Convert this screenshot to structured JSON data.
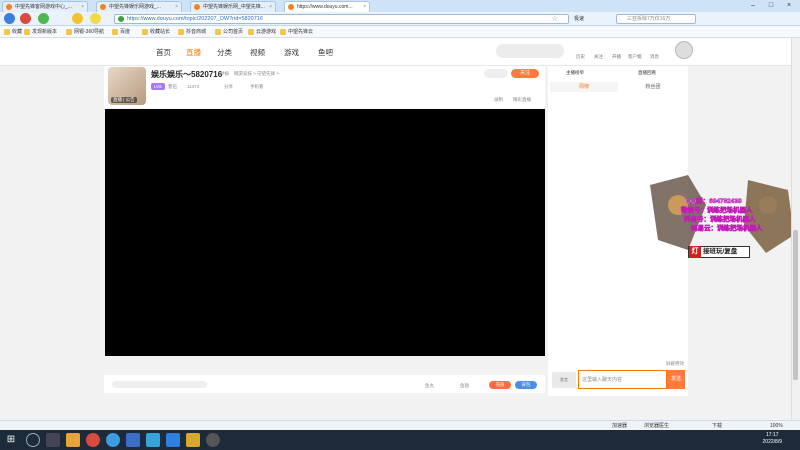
{
  "browser": {
    "tabs": [
      {
        "label": "中望先锋客网游戏中心_...",
        "active": false
      },
      {
        "label": "中望先锋娱乐网游戏_...",
        "active": false
      },
      {
        "label": "中望先锋娱乐网_中望先锋...",
        "active": false
      },
      {
        "label": "https://www.douyu.com...",
        "active": true
      }
    ],
    "url": "https://www.douyu.com/topic/202207_OW?rid=5820716",
    "speed_label": "极速",
    "search_placeholder": "三亚拆除7万仅16万",
    "bookmarks": [
      "收藏",
      "发现新版本",
      "网银-360导航",
      "百度",
      "收藏站长",
      "抖音商城",
      "公司首页",
      "云游游戏",
      "中望先锋云"
    ]
  },
  "site": {
    "nav": [
      "首页",
      "直播",
      "分类",
      "视频",
      "游戏",
      "鱼吧"
    ],
    "active_nav": "直播",
    "header_links": [
      "历史",
      "关注",
      "开播",
      "客户端",
      "消息"
    ]
  },
  "room": {
    "title": "娱乐娱乐～5820716",
    "report": "举报",
    "category": "网游竞技 > 守望先锋 >",
    "level_badge": "LV6",
    "name_short": "鲁伍",
    "hot_count": "11474",
    "share": "分享",
    "mobile_watch": "手机看",
    "follow_label": "关注",
    "avatar_level": "直播 | 公告",
    "record_label": "录制",
    "report_label": "精彩直播"
  },
  "player": {
    "recharge_label": "充值",
    "pack_label": "背包",
    "gift_1": "鱼丸",
    "gift_2": "鱼翅"
  },
  "sidebar": {
    "tab_rank": "主播榜单",
    "tab_gift": "直播回看",
    "tab_weekly": "周榜",
    "tab_fans": "粉丝团",
    "chat_placeholder": "这里输入聊天内容",
    "send_label": "发送",
    "lvl_label": "发言",
    "shield": "屏蔽特效"
  },
  "promo": {
    "line1": "QQ群：694782439",
    "line2": "微信号：训练把场机器人",
    "line3": "抖音号：训练把场机器人",
    "line4": "网易云：训练把场机器人",
    "tag": "接班玩/复盘",
    "tag_mark": "灯"
  },
  "statusbar": {
    "left": "",
    "items": [
      "加速器",
      "浏览器医生",
      "",
      "",
      "",
      "",
      "",
      "",
      "",
      "",
      "",
      "",
      ""
    ],
    "download": "下载",
    "zoom": "100%",
    "rt1": "加速器",
    "rt2": "浏览器医生"
  },
  "taskbar": {
    "time": "17:17",
    "date": "2022/8/9"
  }
}
